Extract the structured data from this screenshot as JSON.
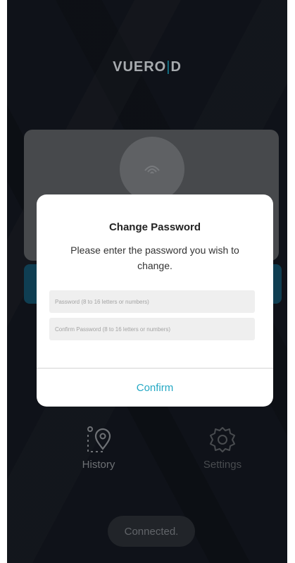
{
  "app": {
    "logo_text_main": "VUERO",
    "logo_text_bar": "|",
    "logo_text_tail": "D"
  },
  "nav": {
    "history_label": "History",
    "settings_label": "Settings"
  },
  "status": {
    "connection_text": "Connected."
  },
  "dialog": {
    "title": "Change Password",
    "message": "Please enter the password you wish to change.",
    "password_placeholder": "Password (8 to 16 letters or numbers)",
    "confirm_placeholder": "Confirm Password (8 to 16 letters or numbers)",
    "confirm_label": "Confirm"
  },
  "colors": {
    "background": "#141820",
    "accent": "#24a8c4",
    "card": "#5b5e62"
  },
  "icons": {
    "history": "location-pin-icon",
    "settings": "gear-icon"
  }
}
